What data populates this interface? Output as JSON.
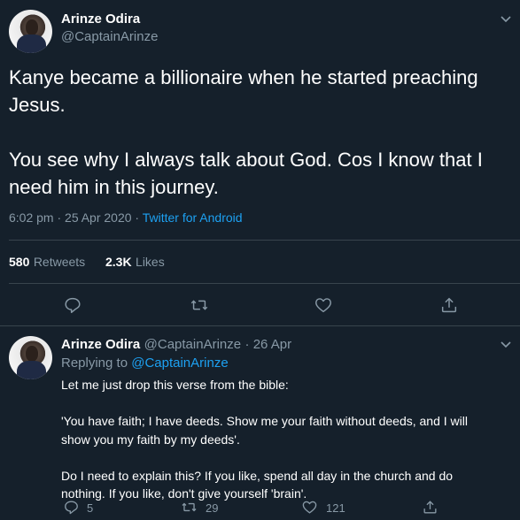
{
  "main_tweet": {
    "author_name": "Arinze Odira",
    "author_handle": "@CaptainArinze",
    "text": "Kanye became a billionaire when he started preaching\nJesus.\n\nYou see why I always talk about God. Cos I know that I\nneed him in this journey.",
    "time": "6:02 pm · 25 Apr 2020 · ",
    "source": "Twitter for Android",
    "retweets_count": "580",
    "retweets_label": "Retweets",
    "likes_count": "2.3K",
    "likes_label": "Likes"
  },
  "reply_tweet": {
    "author_name": "Arinze Odira",
    "author_handle": "@CaptainArinze",
    "date": "· 26 Apr",
    "replying_to_label": "Replying to ",
    "replying_to_handle": "@CaptainArinze",
    "text": "Let me just drop this verse from the bible:\n\n'You have faith; I have deeds. Show me your faith without deeds, and I will\nshow you my faith by my deeds'.\n\nDo I need to explain this? If you like, spend all day in the church and do\nnothing. If you like, don't give yourself 'brain'.",
    "reply_count": "5",
    "retweet_count": "29",
    "like_count": "121"
  },
  "colors": {
    "background": "#15202b",
    "secondary_text": "#8899a6",
    "link": "#1da1f2",
    "divider": "#38444d"
  },
  "icons": [
    "reply-icon",
    "retweet-icon",
    "like-icon",
    "share-icon",
    "chevron-down-icon"
  ]
}
